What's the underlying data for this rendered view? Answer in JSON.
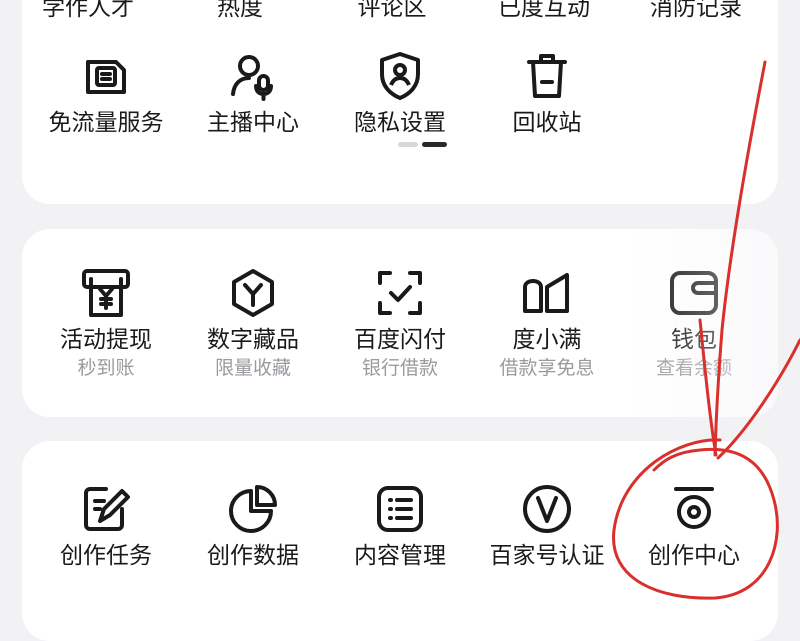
{
  "card1": {
    "cut_labels": [
      "学作人才",
      "热度",
      "评论区",
      "已度互动",
      "消防记录"
    ],
    "items": [
      {
        "label": "免流量服务",
        "icon": "sim-card-icon"
      },
      {
        "label": "主播中心",
        "icon": "anchor-microphone-icon"
      },
      {
        "label": "隐私设置",
        "icon": "privacy-shield-icon"
      },
      {
        "label": "回收站",
        "icon": "trash-icon"
      }
    ]
  },
  "card2": {
    "items": [
      {
        "label": "活动提现",
        "sub": "秒到账",
        "icon": "cash-withdraw-icon"
      },
      {
        "label": "数字藏品",
        "sub": "限量收藏",
        "icon": "digital-collection-icon"
      },
      {
        "label": "百度闪付",
        "sub": "银行借款",
        "icon": "scan-pay-icon"
      },
      {
        "label": "度小满",
        "sub": "借款享免息",
        "icon": "duxiaoman-icon"
      },
      {
        "label": "钱包",
        "sub": "查看余额",
        "icon": "wallet-icon"
      }
    ]
  },
  "card3": {
    "items": [
      {
        "label": "创作任务",
        "icon": "creation-task-icon"
      },
      {
        "label": "创作数据",
        "icon": "pie-chart-icon"
      },
      {
        "label": "内容管理",
        "icon": "content-list-icon"
      },
      {
        "label": "百家号认证",
        "icon": "verified-v-icon"
      },
      {
        "label": "创作中心",
        "icon": "creator-center-icon"
      }
    ]
  },
  "colors": {
    "background": "#f2f2f5",
    "card": "#ffffff",
    "annotation": "#d9302c",
    "subtext": "#9a9aa0"
  }
}
